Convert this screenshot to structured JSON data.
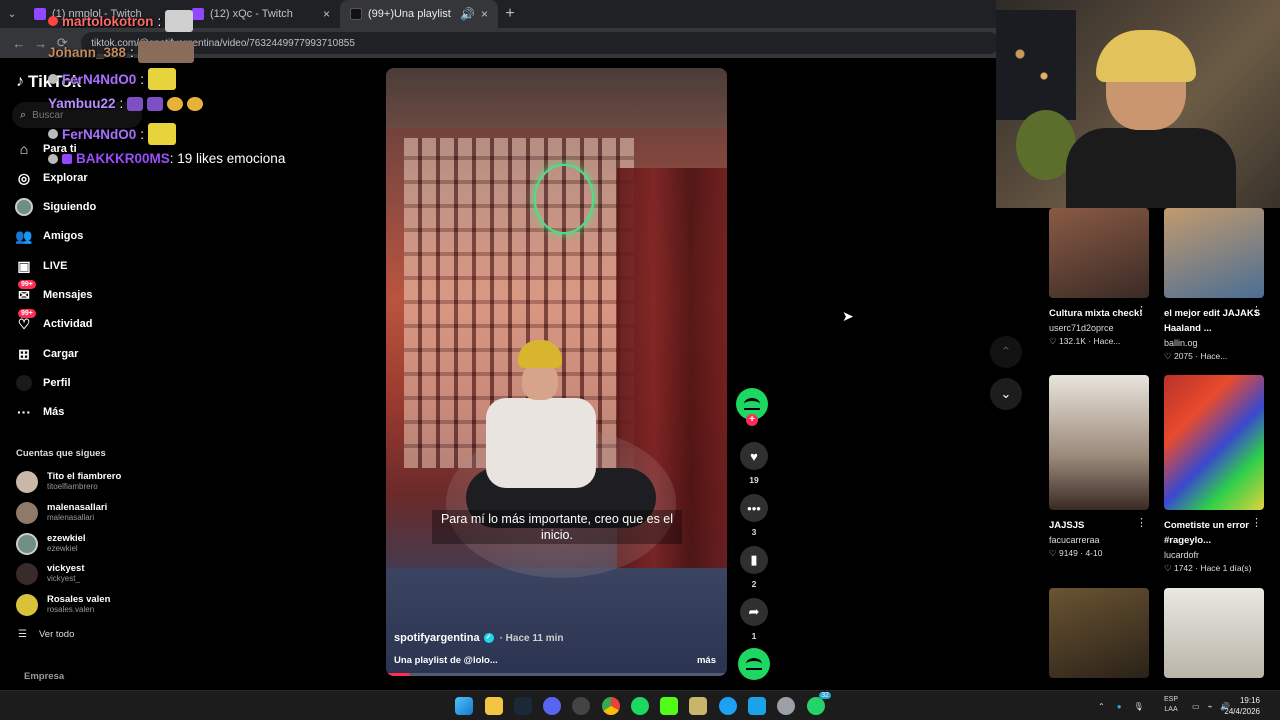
{
  "browser": {
    "tabs": [
      {
        "title": "(1) nmplol - Twitch",
        "active": false
      },
      {
        "title": "(12) xQc - Twitch",
        "active": false
      },
      {
        "title": "(99+)Una playlist de @lolo...",
        "active": true
      }
    ],
    "new_tab": "+",
    "url": "tiktok.com/@spotifyargentina/video/7632449977993710855"
  },
  "chat": [
    {
      "user": "martolokotron",
      "color": "#ff6b6b",
      "msg": ":",
      "emote": true
    },
    {
      "user": "Johann_388",
      "color": "#c28a5e",
      "msg": ":",
      "emote": true
    },
    {
      "user": "FerN4NdO0",
      "color": "#a970ff",
      "msg": ":",
      "emote": true
    },
    {
      "user": "Yambuu22",
      "color": "#b98cff",
      "msg": ":",
      "emote": true
    },
    {
      "user": "FerN4NdO0",
      "color": "#a970ff",
      "msg": ":",
      "emote": true
    },
    {
      "user": "BAKKKR00MS",
      "color": "#9b4dff",
      "msg": ": 19 likes emociona",
      "emote": false
    }
  ],
  "tiktok": {
    "logo": "TikTok",
    "search_placeholder": "Buscar",
    "nav": [
      {
        "label": "Para ti",
        "icon": "home-icon"
      },
      {
        "label": "Explorar",
        "icon": "compass-icon"
      },
      {
        "label": "Siguiendo",
        "icon": "following-icon"
      },
      {
        "label": "Amigos",
        "icon": "friends-icon"
      },
      {
        "label": "LIVE",
        "icon": "live-icon"
      },
      {
        "label": "Mensajes",
        "icon": "messages-icon",
        "badge": "99+"
      },
      {
        "label": "Actividad",
        "icon": "activity-icon",
        "badge": "99+"
      },
      {
        "label": "Cargar",
        "icon": "upload-icon"
      },
      {
        "label": "Perfil",
        "icon": "profile-icon"
      },
      {
        "label": "Más",
        "icon": "more-icon"
      }
    ],
    "following_title": "Cuentas que sigues",
    "following": [
      {
        "name": "Tito el fiambrero",
        "handle": "titoelfiambrero",
        "color": "#c9b8a8"
      },
      {
        "name": "malenasallari",
        "handle": "malenasallari",
        "color": "#8f7a6a"
      },
      {
        "name": "ezewkiel",
        "handle": "ezewkiel",
        "color": "#6f8f86"
      },
      {
        "name": "vickyest",
        "handle": "vickyest_",
        "color": "#3a2b2b"
      },
      {
        "name": "Rosales valen",
        "handle": "rosales.valen",
        "color": "#d8c23a"
      }
    ],
    "see_all": "Ver todo",
    "footer": "Empresa"
  },
  "video": {
    "caption": "Para mí lo más importante, creo que es el inicio.",
    "author": "spotifyargentina",
    "time": "· Hace 11 min",
    "description": "Una playlist de @lolo...",
    "more": "más",
    "progress": 0.07
  },
  "actions": {
    "likes": "19",
    "comments": "3",
    "saves": "2",
    "shares": "1"
  },
  "recommendations": [
    {
      "title": "Cultura mixta check!",
      "user": "userc71d2oprce",
      "stats": "♡ 132.1K · Hace...",
      "color": "#6a5040"
    },
    {
      "title": "el mejor edit JAJAKS Haaland ...",
      "user": "ballin.og",
      "stats": "♡ 2075 · Hace...",
      "color": "#6d8ba8"
    },
    {
      "title": "JAJSJS",
      "user": "facucarreraa",
      "stats": "♡ 9149 · 4-10",
      "color": "#cfc8bd"
    },
    {
      "title": "Cometiste un error #rageylo...",
      "user": "lucardofr",
      "stats": "♡ 1742 · Hace 1 día(s)",
      "color": "#c33a2e"
    },
    {
      "title": "",
      "user": "",
      "stats": "",
      "color": "#5a4a2a"
    },
    {
      "title": "",
      "user": "",
      "stats": "",
      "color": "#d7d7cf"
    }
  ],
  "taskbar": {
    "lang_1": "ESP",
    "lang_2": "LAA",
    "time": "19:16",
    "date": "24/4/2026",
    "whatsapp_badge": "32"
  }
}
